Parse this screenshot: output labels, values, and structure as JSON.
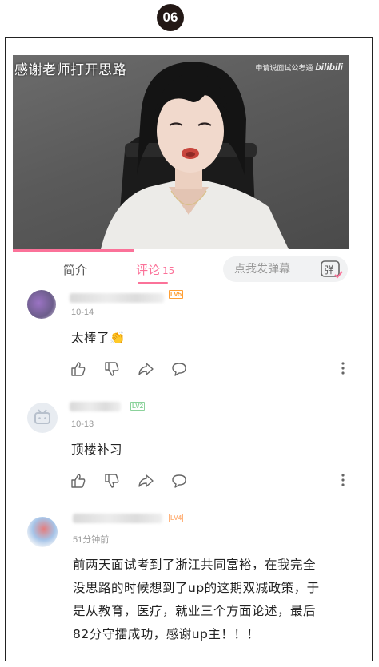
{
  "badge": "06",
  "video": {
    "title": "感谢老师打开思路",
    "watermark_text": "申请说面试公考通",
    "watermark_logo": "bilibili",
    "progress": 0.36
  },
  "tabs": {
    "intro": "简介",
    "comments": "评论",
    "comments_count": "15",
    "danmaku_placeholder": "点我发弹幕",
    "danmaku_button": "弹"
  },
  "comments": [
    {
      "level": "LV5",
      "time": "10-14",
      "text": "太棒了👏"
    },
    {
      "level": "LV2",
      "time": "10-13",
      "text": "顶楼补习"
    },
    {
      "level": "LV4",
      "time": "51分钟前",
      "text_lines": [
        "前两天面试考到了浙江共同富裕，在我完全",
        "没思路的时候想到了up的这期双减政策，于",
        "是从教育，医疗，就业三个方面论述，最后",
        "82分守擂成功，感谢up主！！！"
      ]
    }
  ],
  "colors": {
    "accent": "#fb7299",
    "lv5": "#ff9f33",
    "lv2": "#8bd29b",
    "lv4": "#ffb37c"
  }
}
